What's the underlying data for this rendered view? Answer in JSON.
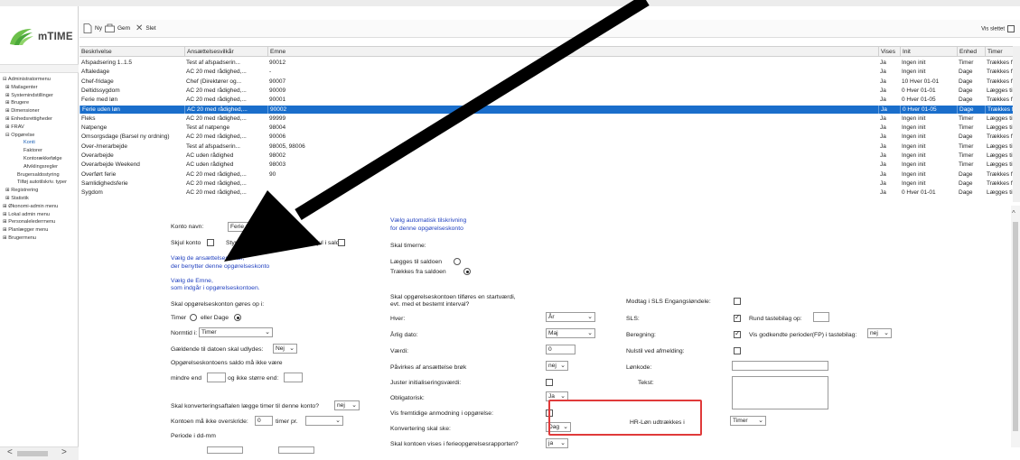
{
  "app": {
    "name": "mTIME"
  },
  "toolbar": {
    "new_label": "Ny",
    "save_label": "Gem",
    "delete_label": "Slet",
    "show_deleted_label": "Vis slettet"
  },
  "nav": {
    "items": [
      {
        "label": "Administratormenu",
        "level": "lvl1",
        "prefix": "⊟ "
      },
      {
        "label": "Mailagenter",
        "level": "lvl2",
        "prefix": "⊞ "
      },
      {
        "label": "Systemindstillinger",
        "level": "lvl2",
        "prefix": "⊞ "
      },
      {
        "label": "Brugere",
        "level": "lvl2",
        "prefix": "⊞ "
      },
      {
        "label": "Dimensioner",
        "level": "lvl2",
        "prefix": "⊞ "
      },
      {
        "label": "Enhedsrettigheder",
        "level": "lvl2",
        "prefix": "⊞ "
      },
      {
        "label": "FRAV",
        "level": "lvl2",
        "prefix": "⊞ "
      },
      {
        "label": "Opgørelse",
        "level": "lvl2",
        "prefix": "⊟ "
      },
      {
        "label": "Konti",
        "level": "lvl3",
        "prefix": "",
        "selected": true
      },
      {
        "label": "Faktorer",
        "level": "lvl3",
        "prefix": ""
      },
      {
        "label": "Kontorækkefølge",
        "level": "lvl3",
        "prefix": ""
      },
      {
        "label": "Afviklingsregler",
        "level": "lvl3",
        "prefix": ""
      },
      {
        "label": "Brugersaldostyring",
        "level": "lvl3b",
        "prefix": ""
      },
      {
        "label": "Tilføj autotilskriv. typer",
        "level": "lvl3b",
        "prefix": ""
      },
      {
        "label": "Registrering",
        "level": "lvl2",
        "prefix": "⊞ "
      },
      {
        "label": "Statistik",
        "level": "lvl2",
        "prefix": "⊞ "
      },
      {
        "label": "Økonomi-admin menu",
        "level": "lvl1",
        "prefix": "⊞ "
      },
      {
        "label": "Lokal admin menu",
        "level": "lvl1",
        "prefix": "⊞ "
      },
      {
        "label": "Personalelederrnenu",
        "level": "lvl1",
        "prefix": "⊞ "
      },
      {
        "label": "Planlægger menu",
        "level": "lvl1",
        "prefix": "⊞ "
      },
      {
        "label": "Brugermenu",
        "level": "lvl1",
        "prefix": "⊞ "
      }
    ]
  },
  "grid": {
    "headers": {
      "beskrivelse": "Beskrivelse",
      "vilkaar": "Ansættelsesvilkår",
      "emne": "Emne",
      "vises": "Vises",
      "init": "Init",
      "enhed": "Enhed",
      "timer": "Timer"
    },
    "rows": [
      {
        "beskrivelse": "Afspadsering 1..1.5",
        "vilkaar": "Test af afspadserin...",
        "emne": "90012",
        "vises": "Ja",
        "init": "Ingen init",
        "enhed": "Timer",
        "timer": "Trækkes fra"
      },
      {
        "beskrivelse": "Aftaledage",
        "vilkaar": "AC 20 med rådighed,...",
        "emne": "-",
        "vises": "Ja",
        "init": "Ingen init",
        "enhed": "Dage",
        "timer": "Trækkes fra"
      },
      {
        "beskrivelse": "Chef-fridage",
        "vilkaar": "Chef (Direktører og...",
        "emne": "90007",
        "vises": "Ja",
        "init": "10 Hver 01-01",
        "enhed": "Dage",
        "timer": "Trækkes fra"
      },
      {
        "beskrivelse": "Deltidssygdom",
        "vilkaar": "AC 20 med rådighed,...",
        "emne": "90009",
        "vises": "Ja",
        "init": "0 Hver 01-01",
        "enhed": "Dage",
        "timer": "Lægges til"
      },
      {
        "beskrivelse": "Ferie med løn",
        "vilkaar": "AC 20 med rådighed,...",
        "emne": "90001",
        "vises": "Ja",
        "init": "0 Hver 01-05",
        "enhed": "Dage",
        "timer": "Trækkes fra"
      },
      {
        "beskrivelse": "Ferie uden løn",
        "vilkaar": "AC 20 med rådighed,...",
        "emne": "90002",
        "vises": "Ja",
        "init": "0 Hver 01-05",
        "enhed": "Dage",
        "timer": "Trækkes fra",
        "selected": true
      },
      {
        "beskrivelse": "Fleks",
        "vilkaar": "AC 20 med rådighed,...",
        "emne": "99999",
        "vises": "Ja",
        "init": "Ingen init",
        "enhed": "Timer",
        "timer": "Lægges til"
      },
      {
        "beskrivelse": "Natpenge",
        "vilkaar": "Test af natpenge",
        "emne": "98004",
        "vises": "Ja",
        "init": "Ingen init",
        "enhed": "Timer",
        "timer": "Lægges til"
      },
      {
        "beskrivelse": "Omsorgsdage (Barsel ny ordning)",
        "vilkaar": "AC 20 med rådighed,...",
        "emne": "90006",
        "vises": "Ja",
        "init": "Ingen init",
        "enhed": "Dage",
        "timer": "Trækkes fra"
      },
      {
        "beskrivelse": "Over-/merarbejde",
        "vilkaar": "Test af afspadserin...",
        "emne": "98005, 98006",
        "vises": "Ja",
        "init": "Ingen init",
        "enhed": "Timer",
        "timer": "Lægges til"
      },
      {
        "beskrivelse": "Overarbejde",
        "vilkaar": "AC uden rådighed",
        "emne": "98002",
        "vises": "Ja",
        "init": "Ingen init",
        "enhed": "Timer",
        "timer": "Lægges til"
      },
      {
        "beskrivelse": "Overarbejde Weekend",
        "vilkaar": "AC uden rådighed",
        "emne": "98003",
        "vises": "Ja",
        "init": "Ingen init",
        "enhed": "Timer",
        "timer": "Lægges til"
      },
      {
        "beskrivelse": "Overført ferie",
        "vilkaar": "AC 20 med rådighed,...",
        "emne": "90",
        "vises": "Ja",
        "init": "Ingen init",
        "enhed": "Dage",
        "timer": "Trækkes fra"
      },
      {
        "beskrivelse": "Samlidighedsferie",
        "vilkaar": "AC 20 med rådighed,...",
        "emne": "",
        "vises": "Ja",
        "init": "Ingen init",
        "enhed": "Dage",
        "timer": "Trækkes fra"
      },
      {
        "beskrivelse": "Sygdom",
        "vilkaar": "AC 20 med rådighed,...",
        "emne": "",
        "vises": "Ja",
        "init": "0 Hver 01-01",
        "enhed": "Dage",
        "timer": "Lægges til"
      }
    ]
  },
  "form": {
    "konto_navn_label": "Konto navn:",
    "konto_navn_value": "Ferie uden løn",
    "skjul_konto_label": "Skjul konto",
    "styres_label": "Styres",
    "skjul_i_saldo_label": "Skjul i saldo",
    "link_vilkaar_1": "Vælg de ansættelsesvilkår,",
    "link_vilkaar_2": "der benytter denne opgørelseskonto",
    "link_emne_1": "Vælg de Emne,",
    "link_emne_2": "som indgår i opgørelseskontoen.",
    "skal_opgores_label": "Skal opgørelseskonton gøres op i:",
    "timer_label": "Timer",
    "eller_dage_label": "eller Dage",
    "normtid_label": "Normtid i:",
    "normtid_value": "Timer",
    "gaeldende_label": "Gældende til datoen skal udlydes:",
    "gaeldende_value": "Nej",
    "saldo_label": "Opgørelseskontoens saldo må ikke være",
    "mindre_end_label": "mindre end",
    "ikke_storre_label": "og ikke større end:",
    "konvertering_aftale_label": "Skal konverteringsaftalen lægge timer til denne konto?",
    "konvertering_aftale_value": "nej",
    "overskride_label": "Kontoen må ikke overskride:",
    "overskride_value": "0",
    "timer_pr_label": "timer pr.",
    "periode_label": "Periode i dd-mm",
    "auto_link_1": "Vælg automatisk tilskrivning",
    "auto_link_2": "for denne opgørelseskonto",
    "skal_timerne_label": "Skal timerne:",
    "laegges_label": "Lægges til saldoen",
    "traekkes_label": "Trækkes fra saldoen",
    "startvaerdi_label_1": "Skal opgørelseskontoen tilføres en startværdi,",
    "startvaerdi_label_2": "evt. med et bestemt interval?",
    "hver_label": "Hver:",
    "hver_value": "År",
    "aarlig_dato_label": "Årlig dato:",
    "aarlig_dato_value": "Maj",
    "vaerdi_label": "Værdi:",
    "vaerdi_value": "0",
    "paavirkes_label": "Påvirkes af ansættelse brøk",
    "paavirkes_value": "nej",
    "juster_label": "Juster initialiseringsværdi:",
    "obligatorisk_label": "Obligatorisk:",
    "obligatorisk_value": "Ja",
    "vis_fremtidige_label": "Vis fremtidige anmodning i opgørelse:",
    "konvertering_ske_label": "Konvertering skal ske:",
    "konvertering_ske_value": "Dag",
    "ferieopgoerelse_label": "Skal kontoen vises i ferieopgørelsesrapporten?",
    "ferieopgoerelse_value": "ja",
    "modtag_sls_label": "Modtag i SLS Engangsløndele:",
    "sls_label": "SLS:",
    "rund_label": "Rund tastebilag op:",
    "beregning_label": "Beregning:",
    "vis_godkendte_label": "Vis godkendte perioder(FP) i tastebilag:",
    "vis_godkendte_value": "nej",
    "nulstil_label": "Nulstil ved afmelding:",
    "loenkode_label": "Lønkode:",
    "tekst_label": "Tekst:",
    "hr_loen_label": "HR-Løn udtrækkes i",
    "hr_loen_value": "Timer"
  },
  "colors": {
    "selection": "#1a6ecb",
    "link": "#1f3fbf",
    "highlight": "#e03a3a",
    "brand_green": "#6cc04a"
  }
}
